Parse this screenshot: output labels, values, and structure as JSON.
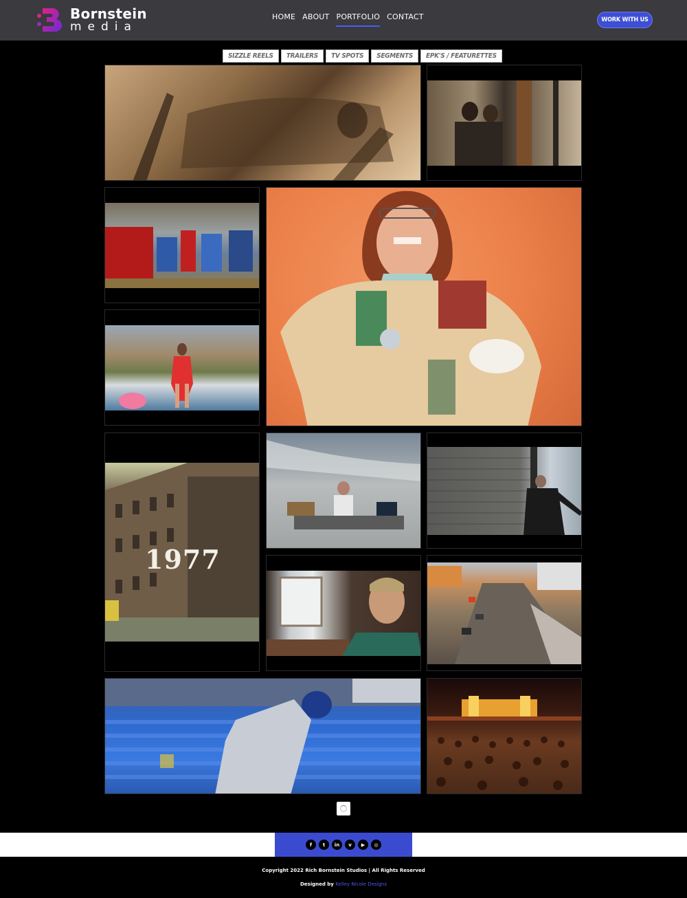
{
  "header": {
    "logo_main": "Bornstein",
    "logo_sub": "media",
    "nav": [
      "HOME",
      "ABOUT",
      "PORTFOLIO",
      "CONTACT"
    ],
    "active_nav": "PORTFOLIO",
    "cta_label": "WORK WITH US"
  },
  "filters": [
    "SIZZLE REELS",
    "TRAILERS",
    "TV SPOTS",
    "SEGMENTS",
    "EPK'S / FEATURETTES"
  ],
  "portfolio": {
    "overlay_text_1977": "1977"
  },
  "footer": {
    "social_icons": [
      "facebook-icon",
      "twitter-icon",
      "linkedin-icon",
      "vimeo-icon",
      "youtube-icon",
      "instagram-icon"
    ],
    "social_glyphs": [
      "f",
      "t",
      "in",
      "v",
      "▶",
      "◎"
    ],
    "copyright": "Copyright 2022 Rich Bornstein Studios | All Rights Reserved",
    "designed_prefix": "Designed by",
    "designed_link": "Kelley Nicole Designs"
  },
  "colors": {
    "header_bg": "#3a3a3f",
    "accent": "#3e4fd4",
    "link": "#4a5cf0"
  }
}
